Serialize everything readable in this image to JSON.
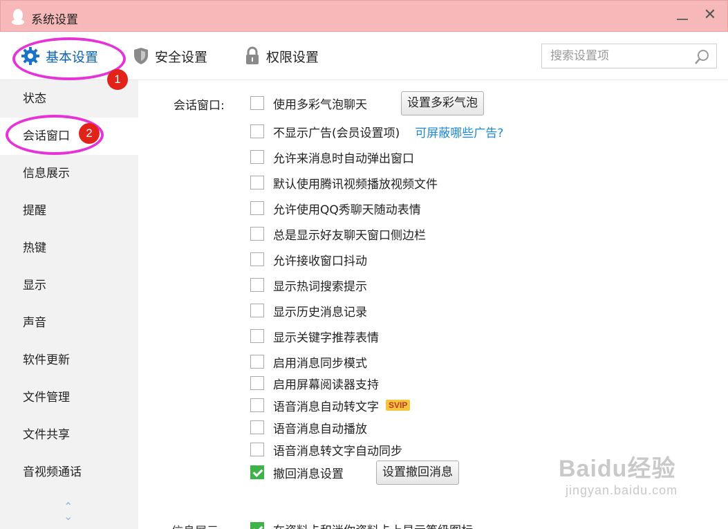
{
  "window": {
    "title": "系统设置"
  },
  "nav": {
    "tabs": [
      {
        "label": "基本设置",
        "icon": "gear-icon"
      },
      {
        "label": "安全设置",
        "icon": "shield-icon"
      },
      {
        "label": "权限设置",
        "icon": "lock-icon"
      }
    ],
    "search_placeholder": "搜索设置项"
  },
  "annotations": {
    "badge1": "1",
    "badge2": "2"
  },
  "sidebar": {
    "items": [
      {
        "label": "状态"
      },
      {
        "label": "会话窗口"
      },
      {
        "label": "信息展示"
      },
      {
        "label": "提醒"
      },
      {
        "label": "热键"
      },
      {
        "label": "显示"
      },
      {
        "label": "声音"
      },
      {
        "label": "软件更新"
      },
      {
        "label": "文件管理"
      },
      {
        "label": "文件共享"
      },
      {
        "label": "音视频通话"
      }
    ],
    "active_index": 1
  },
  "section": {
    "label": "会话窗口:",
    "options": [
      {
        "label": "使用多彩气泡聊天",
        "checked": false
      },
      {
        "label": "不显示广告(会员设置项)",
        "checked": false
      },
      {
        "label": "允许来消息时自动弹出窗口",
        "checked": false
      },
      {
        "label": "默认使用腾讯视频播放视频文件",
        "checked": false
      },
      {
        "label": "允许使用QQ秀聊天随动表情",
        "checked": false
      },
      {
        "label": "总是显示好友聊天窗口侧边栏",
        "checked": false
      },
      {
        "label": "允许接收窗口抖动",
        "checked": false
      },
      {
        "label": "显示热词搜索提示",
        "checked": false
      },
      {
        "label": "显示历史消息记录",
        "checked": false
      },
      {
        "label": "显示关键字推荐表情",
        "checked": false
      },
      {
        "label": "启用消息同步模式",
        "checked": false
      },
      {
        "label": "启用屏幕阅读器支持",
        "checked": false
      },
      {
        "label": "语音消息自动转文字",
        "checked": false
      },
      {
        "label": "语音消息自动播放",
        "checked": false
      },
      {
        "label": "语音消息转文字自动同步",
        "checked": false
      },
      {
        "label": "撤回消息设置",
        "checked": true
      }
    ],
    "bubble_button": "设置多彩气泡",
    "ads_link": "可屏蔽哪些广告?",
    "svip_badge": "SVIP",
    "recall_button": "设置撤回消息"
  },
  "next_section": {
    "label": "信息展示:",
    "option": "在资料卡和迷你资料卡上显示等级图标",
    "checked": true
  },
  "watermark": {
    "brand": "Baidu经验",
    "url": "jingyan.baidu.com"
  },
  "colors": {
    "titlebar": "#f6b8b8",
    "accent": "#0a63b6",
    "highlight_ring": "#e633d8",
    "badge": "#e2231a",
    "check": "#3db34a",
    "link": "#1e88d6"
  }
}
